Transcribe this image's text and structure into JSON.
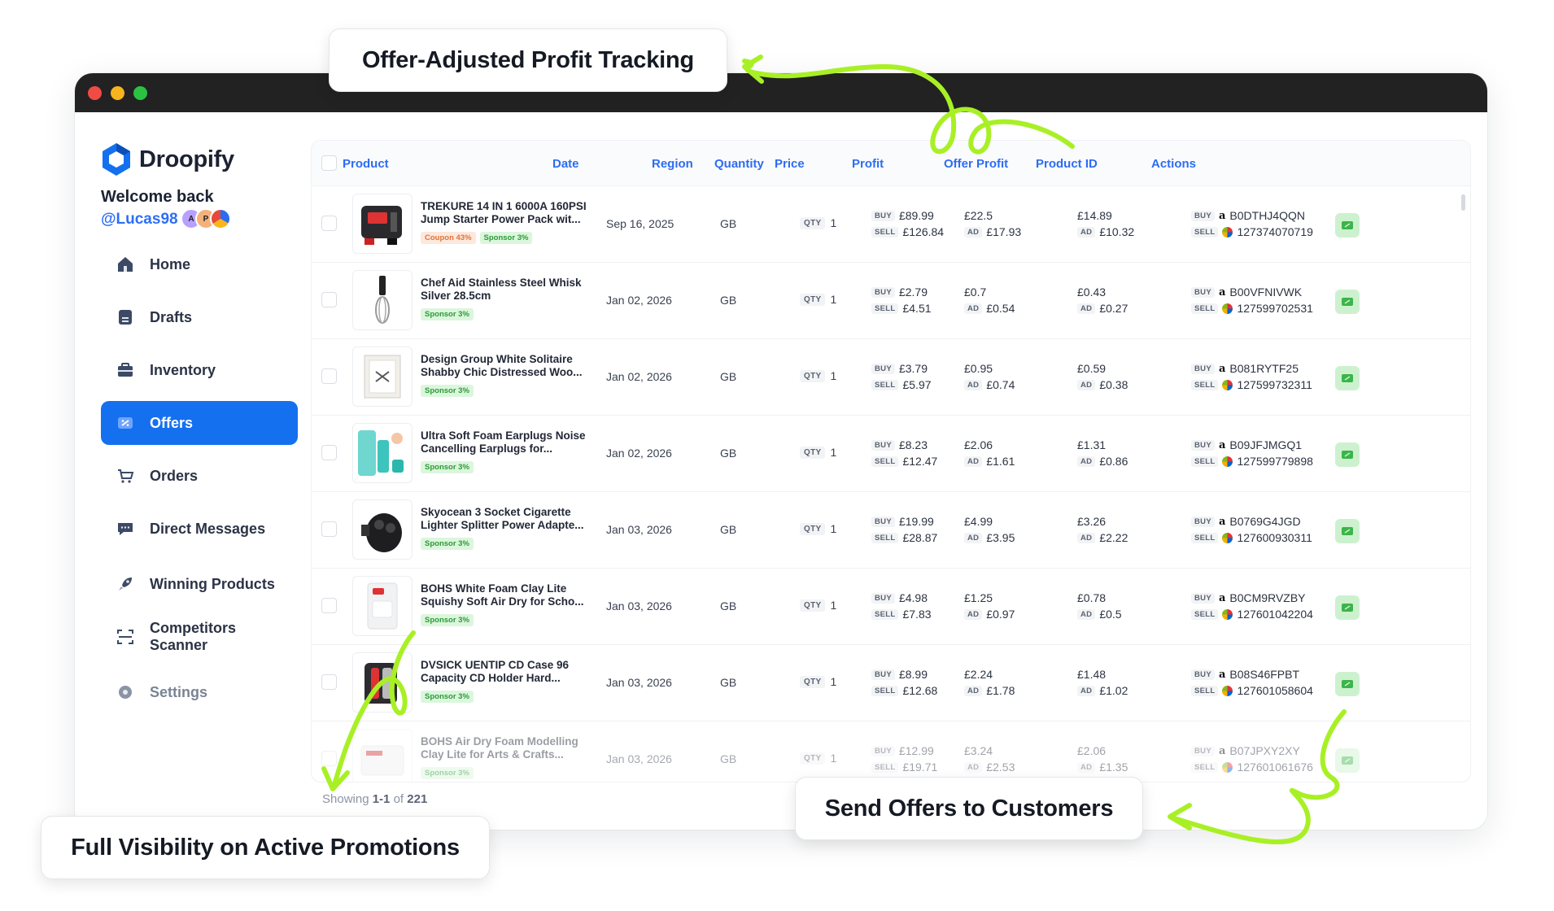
{
  "brand": {
    "name": "Droopify"
  },
  "user": {
    "welcome": "Welcome back",
    "handle": "@Lucas98",
    "avatars": [
      "A",
      "P",
      ""
    ]
  },
  "nav": [
    {
      "label": "Home",
      "icon": "home-icon"
    },
    {
      "label": "Drafts",
      "icon": "drafts-icon"
    },
    {
      "label": "Inventory",
      "icon": "inventory-icon"
    },
    {
      "label": "Offers",
      "icon": "offers-icon",
      "active": true
    },
    {
      "label": "Orders",
      "icon": "cart-icon"
    },
    {
      "label": "Direct Messages",
      "icon": "chat-icon"
    },
    {
      "label": "Winning Products",
      "icon": "rocket-icon"
    },
    {
      "label": "Competitors Scanner",
      "icon": "scanner-icon"
    },
    {
      "label": "Settings",
      "icon": "gear-icon"
    }
  ],
  "table": {
    "headers": {
      "product": "Product",
      "date": "Date",
      "region": "Region",
      "quantity": "Quantity",
      "price": "Price",
      "profit": "Profit",
      "offer_profit": "Offer Profit",
      "product_id": "Product ID",
      "actions": "Actions"
    },
    "keys": {
      "buy": "BUY",
      "sell": "SELL",
      "ad": "AD",
      "qty": "QTY"
    },
    "rows": [
      {
        "name": "TREKURE 14 IN 1 6000A 160PSI Jump Starter Power Pack wit...",
        "tags": [
          {
            "text": "Coupon 43%",
            "kind": "coupon"
          },
          {
            "text": "Sponsor 3%",
            "kind": "sponsor"
          }
        ],
        "date": "Sep 16, 2025",
        "region": "GB",
        "qty": "1",
        "buy": "£89.99",
        "sell": "£126.84",
        "profit": "£22.5",
        "profit_ad": "£17.93",
        "offer_profit": "£14.89",
        "offer_ad": "£10.32",
        "asin": "B0DTHJ4QQN",
        "item_id": "127374070719",
        "thumb": "jumpstarter"
      },
      {
        "name": "Chef Aid Stainless Steel Whisk Silver 28.5cm",
        "tags": [
          {
            "text": "Sponsor 3%",
            "kind": "sponsor"
          }
        ],
        "date": "Jan 02, 2026",
        "region": "GB",
        "qty": "1",
        "buy": "£2.79",
        "sell": "£4.51",
        "profit": "£0.7",
        "profit_ad": "£0.54",
        "offer_profit": "£0.43",
        "offer_ad": "£0.27",
        "asin": "B00VFNIVWK",
        "item_id": "127599702531",
        "thumb": "whisk"
      },
      {
        "name": "Design Group White Solitaire Shabby Chic Distressed Woo...",
        "tags": [
          {
            "text": "Sponsor 3%",
            "kind": "sponsor"
          }
        ],
        "date": "Jan 02, 2026",
        "region": "GB",
        "qty": "1",
        "buy": "£3.79",
        "sell": "£5.97",
        "profit": "£0.95",
        "profit_ad": "£0.74",
        "offer_profit": "£0.59",
        "offer_ad": "£0.38",
        "asin": "B081RYTF25",
        "item_id": "127599732311",
        "thumb": "frame"
      },
      {
        "name": "Ultra Soft Foam Earplugs Noise Cancelling Earplugs for...",
        "tags": [
          {
            "text": "Sponsor 3%",
            "kind": "sponsor"
          }
        ],
        "date": "Jan 02, 2026",
        "region": "GB",
        "qty": "1",
        "buy": "£8.23",
        "sell": "£12.47",
        "profit": "£2.06",
        "profit_ad": "£1.61",
        "offer_profit": "£1.31",
        "offer_ad": "£0.86",
        "asin": "B09JFJMGQ1",
        "item_id": "127599779898",
        "thumb": "earplugs"
      },
      {
        "name": "Skyocean 3 Socket Cigarette Lighter Splitter Power Adapte...",
        "tags": [
          {
            "text": "Sponsor 3%",
            "kind": "sponsor"
          }
        ],
        "date": "Jan 03, 2026",
        "region": "GB",
        "qty": "1",
        "buy": "£19.99",
        "sell": "£28.87",
        "profit": "£4.99",
        "profit_ad": "£3.95",
        "offer_profit": "£3.26",
        "offer_ad": "£2.22",
        "asin": "B0769G4JGD",
        "item_id": "127600930311",
        "thumb": "splitter"
      },
      {
        "name": "BOHS White Foam Clay Lite Squishy Soft Air Dry for Scho...",
        "tags": [
          {
            "text": "Sponsor 3%",
            "kind": "sponsor"
          }
        ],
        "date": "Jan 03, 2026",
        "region": "GB",
        "qty": "1",
        "buy": "£4.98",
        "sell": "£7.83",
        "profit": "£1.25",
        "profit_ad": "£0.97",
        "offer_profit": "£0.78",
        "offer_ad": "£0.5",
        "asin": "B0CM9RVZBY",
        "item_id": "127601042204",
        "thumb": "clay"
      },
      {
        "name": "DVSICK UENTIP CD Case 96 Capacity CD Holder Hard...",
        "tags": [
          {
            "text": "Sponsor 3%",
            "kind": "sponsor"
          }
        ],
        "date": "Jan 03, 2026",
        "region": "GB",
        "qty": "1",
        "buy": "£8.99",
        "sell": "£12.68",
        "profit": "£2.24",
        "profit_ad": "£1.78",
        "offer_profit": "£1.48",
        "offer_ad": "£1.02",
        "asin": "B08S46FPBT",
        "item_id": "127601058604",
        "thumb": "cdcase"
      },
      {
        "name": "BOHS Air Dry Foam Modelling Clay Lite for Arts & Crafts...",
        "tags": [
          {
            "text": "Sponsor 3%",
            "kind": "sponsor"
          }
        ],
        "date": "Jan 03, 2026",
        "region": "GB",
        "qty": "1",
        "buy": "£12.99",
        "sell": "£19.71",
        "profit": "£3.24",
        "profit_ad": "£2.53",
        "offer_profit": "£2.06",
        "offer_ad": "£1.35",
        "asin": "B07JPXY2XY",
        "item_id": "127601061676",
        "thumb": "clay2"
      }
    ],
    "footer": {
      "prefix": "Showing",
      "range": "1-1",
      "of": "of",
      "total": "221"
    }
  },
  "callouts": {
    "top": "Offer-Adjusted Profit Tracking",
    "bottom_left": "Full Visibility on Active Promotions",
    "bottom_right": "Send Offers to Customers"
  },
  "colors": {
    "accent": "#1570ef",
    "header_text": "#2d6df3",
    "arrow": "#a8f025",
    "action_bg": "#cdf1cf"
  }
}
